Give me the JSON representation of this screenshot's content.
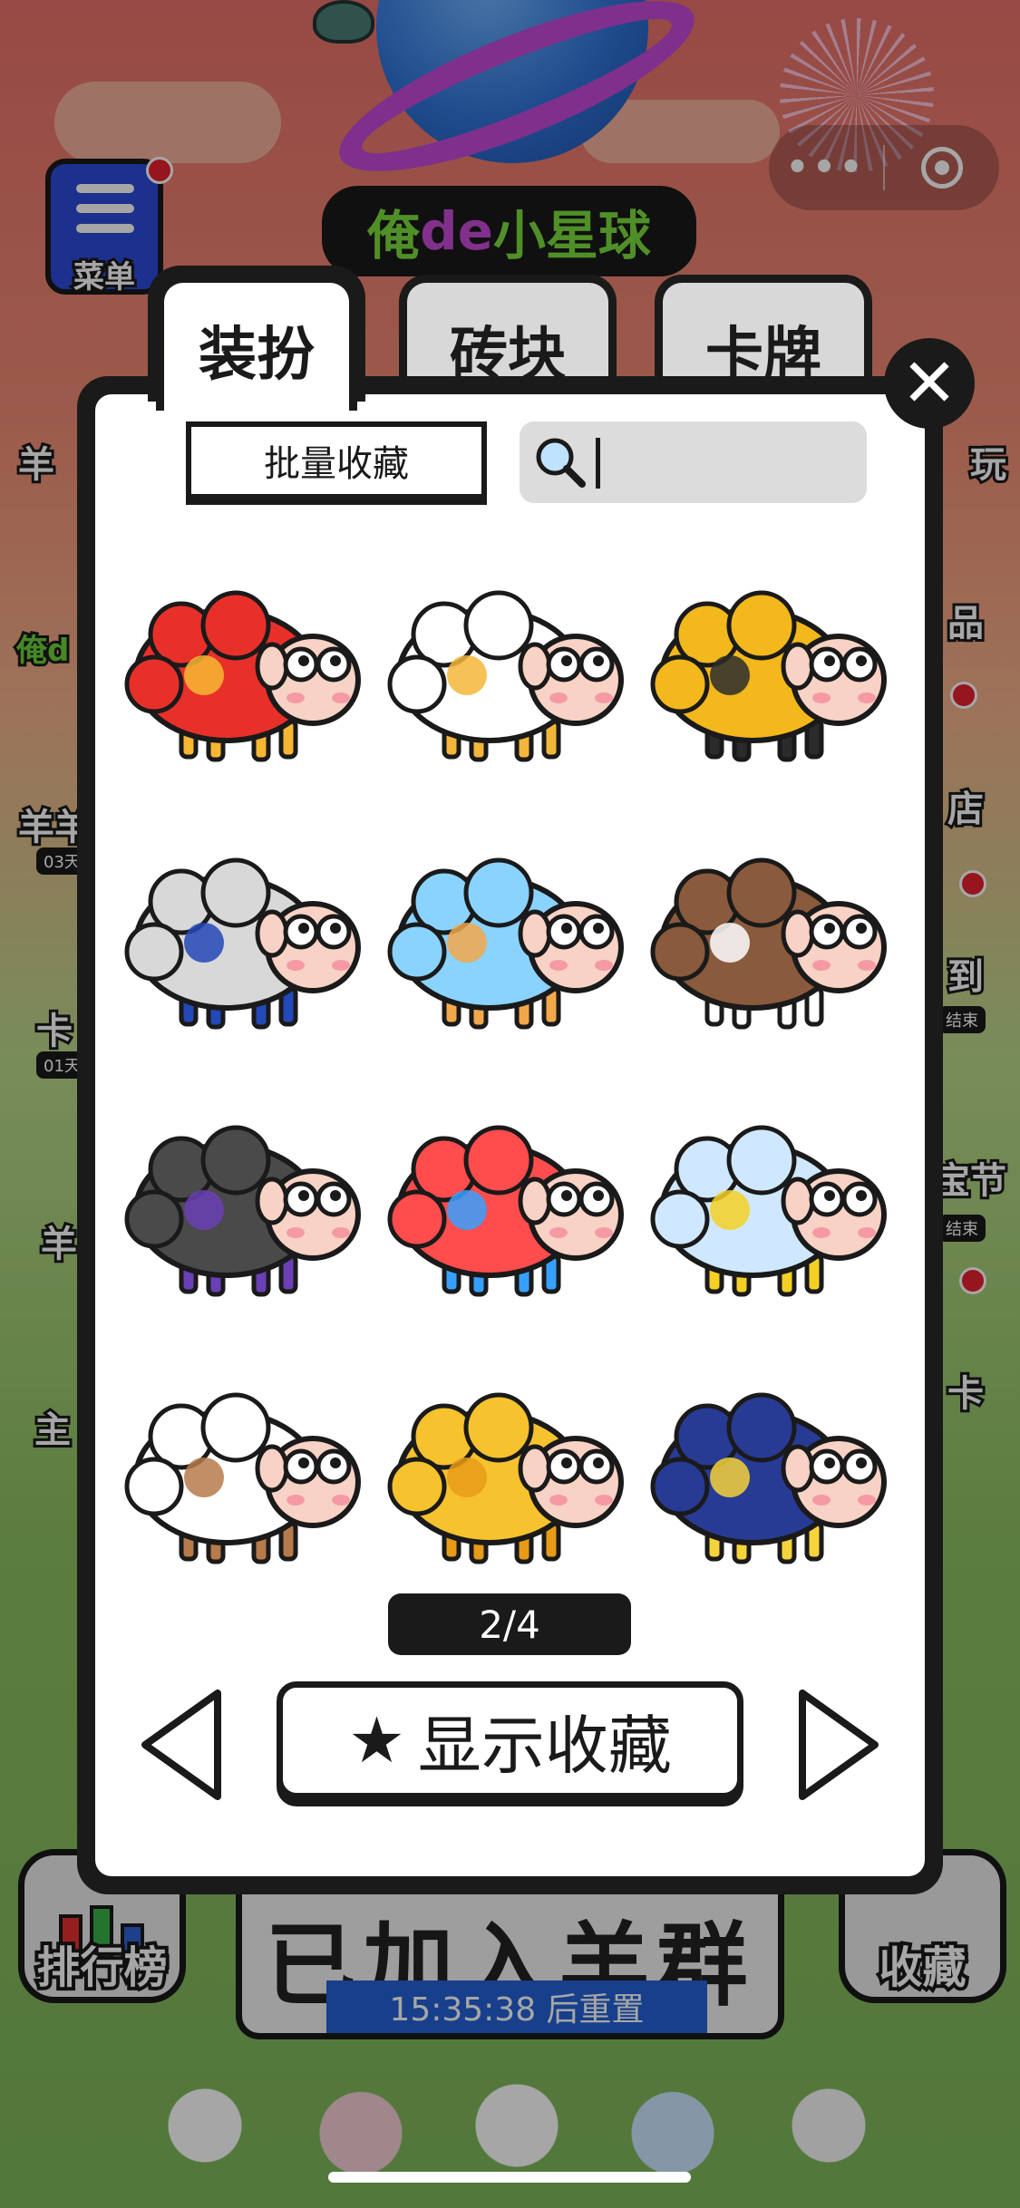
{
  "app": {
    "title_part1": "俺",
    "title_part2": "de",
    "title_part3": "小星球",
    "menu_label": "菜单"
  },
  "capsule": {
    "more_icon": "more-dots-icon",
    "close_icon": "target-icon"
  },
  "background": {
    "side_labels_left": [
      "羊",
      "俺d",
      "羊羊",
      "卡",
      "羊",
      "主"
    ],
    "side_labels_right": [
      "玩",
      "品",
      "店",
      "到",
      "宝节",
      "卡"
    ],
    "side_pills_left": [
      "03天",
      "01天"
    ],
    "side_pills_right": [
      "结束",
      "结束"
    ],
    "rank_label": "排行榜",
    "fav_label": "收藏",
    "group_title": "已加入羊群",
    "reset_timer": "15:35:38 后重置"
  },
  "modal": {
    "tabs": [
      {
        "label": "装扮",
        "active": true
      },
      {
        "label": "砖块",
        "active": false
      },
      {
        "label": "卡牌",
        "active": false
      }
    ],
    "batch_button": "批量收藏",
    "search": {
      "value": "",
      "icon": "search-icon"
    },
    "skins": [
      {
        "name": "mushroom-sheep",
        "colors": [
          "#e8302a",
          "#f7b733"
        ]
      },
      {
        "name": "crane-sheep",
        "colors": [
          "#ffffff",
          "#f4b63a"
        ]
      },
      {
        "name": "excavator-sheep",
        "colors": [
          "#f2b81c",
          "#2b2b2b"
        ]
      },
      {
        "name": "astronaut-sheep",
        "colors": [
          "#d8d8d8",
          "#2348b7"
        ]
      },
      {
        "name": "beach-sheep",
        "colors": [
          "#8ad3ff",
          "#f2a74a"
        ]
      },
      {
        "name": "detective-sheep",
        "colors": [
          "#8a5a3c",
          "#ffffff"
        ]
      },
      {
        "name": "magician-sheep",
        "colors": [
          "#4a4a4a",
          "#6b3fb5"
        ]
      },
      {
        "name": "rainbow-sheep",
        "colors": [
          "#ff4c4c",
          "#37a0ff"
        ]
      },
      {
        "name": "cloud-sheep",
        "colors": [
          "#cfe8ff",
          "#f5d024"
        ]
      },
      {
        "name": "dessert-sheep",
        "colors": [
          "#ffffff",
          "#b77a4a"
        ]
      },
      {
        "name": "honey-sheep",
        "colors": [
          "#f6c22e",
          "#e79b17"
        ]
      },
      {
        "name": "night-sky-sheep",
        "colors": [
          "#283b94",
          "#f4d43a"
        ]
      }
    ],
    "pager": "2/4",
    "show_favorites": "显示收藏",
    "prev_icon": "prev-arrow-icon",
    "next_icon": "next-arrow-icon",
    "close_icon": "close-icon"
  }
}
